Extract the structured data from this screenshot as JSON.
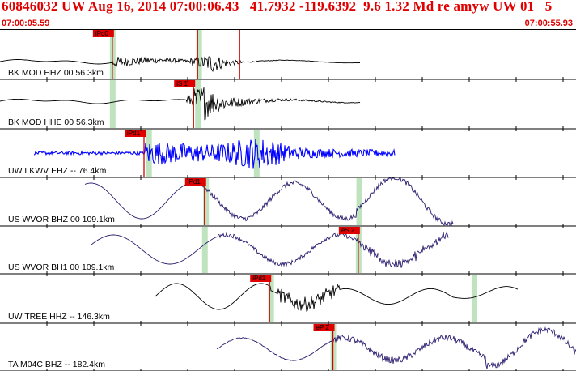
{
  "header": {
    "title": "60846032 UW Aug 16, 2014 07:00:06.43   41.7932 -119.6392  9.6 1.32 Md re amyw UW 01   5",
    "start_time": "07:00:05.59",
    "end_time": "07:00:55.93"
  },
  "colors": {
    "header_text": "#e00000",
    "pick_box": "#e00000",
    "pick_line": "#d00000",
    "window": "#bfe3bf",
    "blue": "#0000ff",
    "black": "#000000",
    "navy": "#2a1a6e"
  },
  "chart_data": {
    "type": "line",
    "title": "60846032 UW Aug 16, 2014 07:00:06.43   41.7932 -119.6392  9.6 1.32 Md re amyw UW 01   5",
    "x_range": [
      "07:00:05.59",
      "07:00:55.93"
    ],
    "grid": false,
    "series": [
      {
        "name": "BK MOD HHZ 00 56.3km",
        "color": "#000000",
        "picks": [
          {
            "label": "iPd0",
            "time_frac": 0.195
          },
          {
            "label": "",
            "time_frac": 0.343
          },
          {
            "label": "",
            "time_frac": 0.416
          }
        ],
        "windows": [
          0.195,
          0.345
        ]
      },
      {
        "name": "BK MOD HHE 00 56.3km",
        "color": "#000000",
        "picks": [
          {
            "label": "iS 1",
            "time_frac": 0.336
          }
        ],
        "windows": [
          0.195,
          0.343
        ]
      },
      {
        "name": "UW LKWV EHZ -- 76.4km",
        "color": "#0000ff",
        "picks": [
          {
            "label": "iPd1",
            "time_frac": 0.25
          }
        ],
        "windows": [
          0.258,
          0.445
        ]
      },
      {
        "name": "US WVOR BHZ 00 109.1km",
        "color": "#2a1a6e",
        "picks": [
          {
            "label": "iPd1",
            "time_frac": 0.355
          }
        ],
        "windows": [
          0.357,
          0.623
        ]
      },
      {
        "name": "US WVOR BH1 00 109.1km",
        "color": "#2a1a6e",
        "picks": [
          {
            "label": "eS 2",
            "time_frac": 0.622
          }
        ],
        "windows": [
          0.355,
          0.622
        ]
      },
      {
        "name": "UW TREE HHZ -- 146.3km",
        "color": "#000000",
        "picks": [
          {
            "label": "iPd1",
            "time_frac": 0.468
          }
        ],
        "windows": [
          0.47,
          0.823
        ]
      },
      {
        "name": "TA M04C BHZ -- 182.4km",
        "color": "#2a1a6e",
        "picks": [
          {
            "label": "eP 2",
            "time_frac": 0.578
          }
        ],
        "windows": [
          0.578
        ]
      }
    ]
  }
}
